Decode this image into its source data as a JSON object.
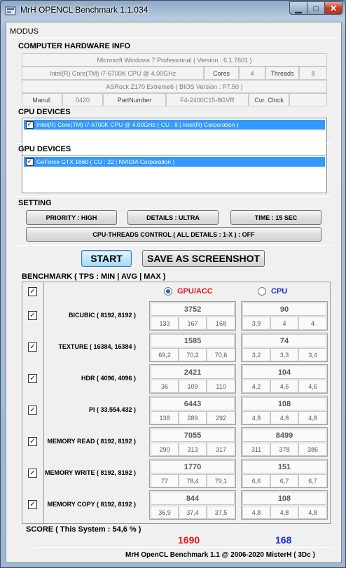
{
  "window": {
    "title": "MrH OPENCL Benchmark 1.1.034"
  },
  "modus_label": "MODUS",
  "hardware": {
    "heading": "COMPUTER HARDWARE INFO",
    "os": "Microsoft Windows 7 Professional  ( Version : 6.1.7601 )",
    "cpu": "Intel(R) Core(TM) i7-6700K CPU @ 4.00GHz",
    "cores_label": "Cores",
    "cores": "4",
    "threads_label": "Threads",
    "threads": "8",
    "board": "ASRock Z170 Extreme6  ( BIOS Version : P7.50 )",
    "manuf_label": "Manuf.",
    "manuf": "0420",
    "partnumber_label": "PartNumber",
    "partnumber": "F4-2400C15-8GVR",
    "curclock_label": "Cur. Clock",
    "curclock": ""
  },
  "cpu_devices": {
    "heading": "CPU DEVICES",
    "items": [
      "Intel(R) Core(TM) i7-6700K CPU @ 4.00GHz  ( CU : 8  |  Intel(R) Corporation )"
    ]
  },
  "gpu_devices": {
    "heading": "GPU DEVICES",
    "items": [
      "GeForce GTX 1660  ( CU : 22  |  NVIDIA Corporation )"
    ]
  },
  "setting": {
    "heading": "SETTING",
    "priority": "PRIORITY : HIGH",
    "details": "DETAILS : ULTRA",
    "time": "TIME : 15 SEC",
    "threads_control": "CPU-THREADS CONTROL ( ALL DETAILS : 1-X ) : OFF"
  },
  "actions": {
    "start": "START",
    "screenshot": "SAVE AS SCREENSHOT"
  },
  "benchmark": {
    "heading": "BENCHMARK ( TPS : MIN | AVG | MAX )",
    "gpu_label": "GPU/ACC",
    "cpu_label": "CPU",
    "selected_mode": "GPU/ACC",
    "colors": {
      "gpu": "#e8141c",
      "cpu": "#1a2ee0"
    },
    "rows": [
      {
        "name": "BICUBIC ( 8192, 8192 )",
        "gpu": {
          "avg": "3752",
          "min": "133",
          "med": "167",
          "max": "168"
        },
        "cpu": {
          "avg": "90",
          "min": "3,9",
          "med": "4",
          "max": "4"
        }
      },
      {
        "name": "TEXTURE ( 16384, 16384 )",
        "gpu": {
          "avg": "1585",
          "min": "69,2",
          "med": "70,2",
          "max": "70,6"
        },
        "cpu": {
          "avg": "74",
          "min": "3,2",
          "med": "3,3",
          "max": "3,4"
        }
      },
      {
        "name": "HDR ( 4096, 4096 )",
        "gpu": {
          "avg": "2421",
          "min": "36",
          "med": "109",
          "max": "110"
        },
        "cpu": {
          "avg": "104",
          "min": "4,2",
          "med": "4,6",
          "max": "4,6"
        }
      },
      {
        "name": "PI ( 33.554.432 )",
        "gpu": {
          "avg": "6443",
          "min": "138",
          "med": "289",
          "max": "292"
        },
        "cpu": {
          "avg": "108",
          "min": "4,8",
          "med": "4,8",
          "max": "4,8"
        }
      },
      {
        "name": "MEMORY READ ( 8192, 8192 )",
        "gpu": {
          "avg": "7055",
          "min": "290",
          "med": "313",
          "max": "317"
        },
        "cpu": {
          "avg": "8499",
          "min": "311",
          "med": "378",
          "max": "386"
        }
      },
      {
        "name": "MEMORY WRITE ( 8192, 8192 )",
        "gpu": {
          "avg": "1770",
          "min": "77",
          "med": "78,4",
          "max": "79,1"
        },
        "cpu": {
          "avg": "151",
          "min": "6,6",
          "med": "6,7",
          "max": "6,7"
        }
      },
      {
        "name": "MEMORY COPY ( 8192, 8192 )",
        "gpu": {
          "avg": "844",
          "min": "36,9",
          "med": "37,4",
          "max": "37,5"
        },
        "cpu": {
          "avg": "108",
          "min": "4,8",
          "med": "4,8",
          "max": "4,8"
        }
      }
    ]
  },
  "score": {
    "label": "SCORE ( This System : 54,6 % )",
    "gpu": "1690",
    "cpu": "168"
  },
  "footer": "MrH OpenCL Benchmark 1.1  @  2006-2020  MisterH  ( 3Dc )"
}
